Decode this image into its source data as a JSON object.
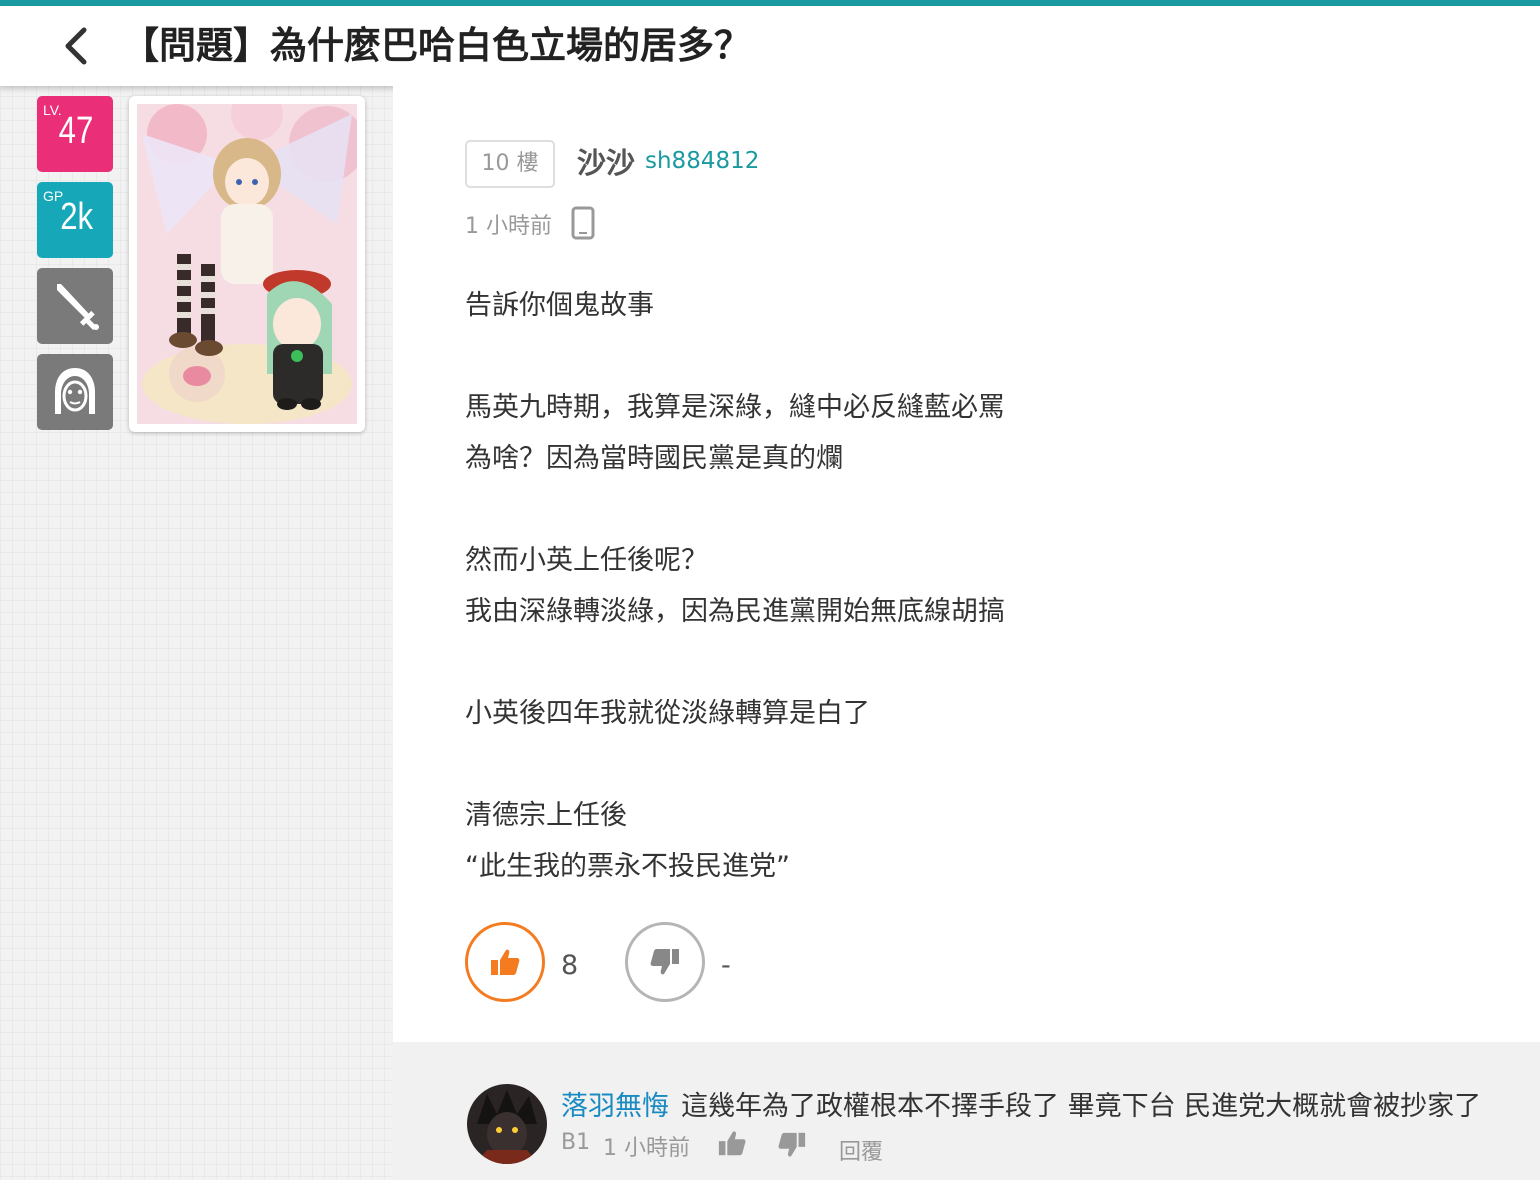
{
  "header": {
    "title": "【問題】為什麼巴哈白色立場的居多？",
    "accent_color": "#1a9aa0"
  },
  "user_stats": {
    "level_label": "LV.",
    "level": "47",
    "gp_label": "GP",
    "gp": "2k",
    "level_color": "#ea2e78",
    "gp_color": "#16a8b8",
    "icons": [
      "sword-icon",
      "hooded-character-icon"
    ]
  },
  "post": {
    "floor": "10 樓",
    "author_name": "沙沙",
    "author_id": "sh884812",
    "time": "1 小時前",
    "device_icon": "mobile-phone-icon",
    "lines": [
      "告訴你個鬼故事",
      "",
      "馬英九時期，我算是深綠，縫中必反縫藍必罵",
      "為啥？因為當時國民黨是真的爛",
      "",
      "然而小英上任後呢？",
      "我由深綠轉淡綠，因為民進黨開始無底線胡搞",
      "",
      "小英後四年我就從淡綠轉算是白了",
      "",
      "清德宗上任後",
      "“此生我的票永不投民進党”"
    ],
    "like_count": "8",
    "dislike_count": "-",
    "like_color": "#f57b20"
  },
  "comment": {
    "author": "落羽無悔",
    "text": "這幾年為了政權根本不擇手段了 畢竟下台 民進党大概就會被抄家了",
    "floor": "B1",
    "time": "1 小時前",
    "reply_label": "回覆"
  }
}
